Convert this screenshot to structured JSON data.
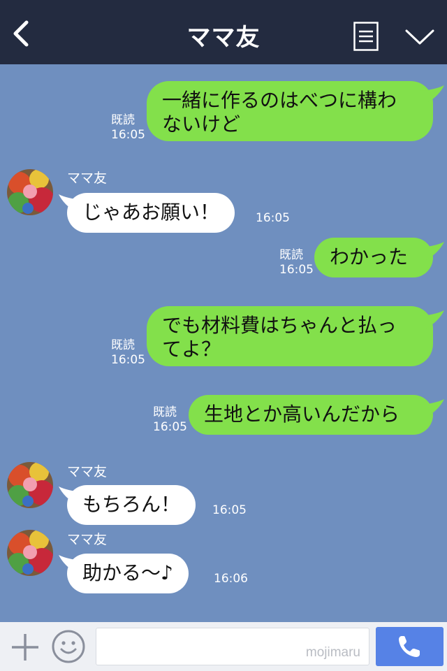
{
  "header": {
    "title": "ママ友",
    "back_icon": "chevron-left-icon",
    "menu_icon": "menu-list-icon",
    "collapse_icon": "chevron-down-icon"
  },
  "contact": {
    "name": "ママ友",
    "avatar": "avatar"
  },
  "messages": [
    {
      "side": "out",
      "lines": [
        "一緒に作るのはべつに構わ",
        "ないけど"
      ],
      "read": "既読",
      "time": "16:05"
    },
    {
      "side": "in",
      "sender": "ママ友",
      "lines": [
        "じゃあお願い！"
      ],
      "time": "16:05"
    },
    {
      "side": "out",
      "lines": [
        "わかった"
      ],
      "read": "既読",
      "time": "16:05"
    },
    {
      "side": "out",
      "lines": [
        "でも材料費はちゃんと払っ",
        "てよ？"
      ],
      "read": "既読",
      "time": "16:05"
    },
    {
      "side": "out",
      "lines": [
        "生地とか高いんだから"
      ],
      "read": "既読",
      "time": "16:05"
    },
    {
      "side": "in",
      "sender": "ママ友",
      "lines": [
        "もちろん！"
      ],
      "time": "16:05"
    },
    {
      "side": "in",
      "sender": "ママ友",
      "lines": [
        "助かる〜♪"
      ],
      "time": "16:06"
    }
  ],
  "footer": {
    "plus_icon": "plus-icon",
    "emoji_icon": "emoji-icon",
    "input_value": "",
    "watermark": "mojimaru",
    "call_icon": "phone-icon"
  },
  "colors": {
    "header_bg": "#232b40",
    "chat_bg": "#6f8fbf",
    "outgoing_bubble": "#83e04b",
    "incoming_bubble": "#ffffff",
    "call_button": "#5682e6"
  }
}
